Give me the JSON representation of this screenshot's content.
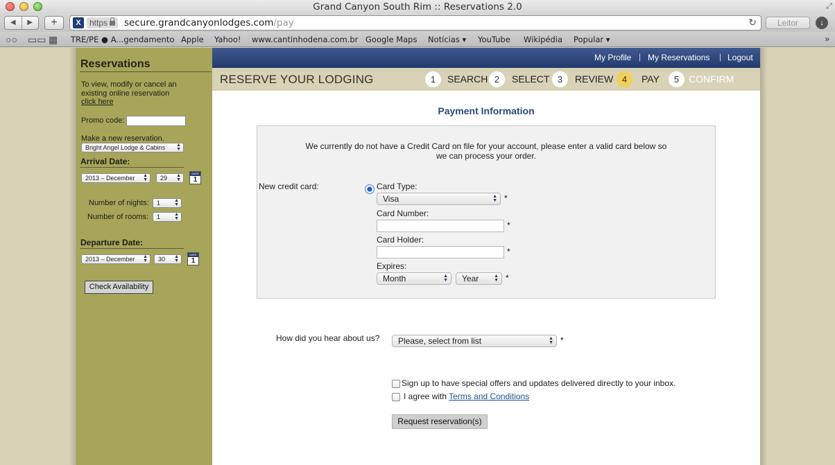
{
  "window": {
    "title": "Grand Canyon South Rim :: Reservations 2.0"
  },
  "browser": {
    "url_scheme": "https",
    "url_host": "secure.grandcanyonlodges.com",
    "url_path": "/pay",
    "reader_label": "Leitor",
    "bookmarks": [
      "TRE/PE ● A...gendamento",
      "Apple",
      "Yahoo!",
      "www.cantinhodena.com.br",
      "Google Maps",
      "Notícias ▾",
      "YouTube",
      "Wikipédia",
      "Popular ▾"
    ]
  },
  "sidebar": {
    "title": "Reservations",
    "modify_text": "To view, modify or cancel an existing online reservation",
    "click_here": "click here",
    "promo_label": "Promo code:",
    "promo_value": "",
    "new_res_label": "Make a new reservation.",
    "lodge_select": "Bright Angel Lodge & Cabins",
    "arrival_head": "Arrival Date:",
    "arrival_month": "2013 – December",
    "arrival_day": "29",
    "nights_label": "Number of nights:",
    "nights_value": "1",
    "rooms_label": "Number of rooms:",
    "rooms_value": "1",
    "departure_head": "Departure Date:",
    "departure_month": "2013 – December",
    "departure_day": "30",
    "cal_label": "DATE",
    "cal_num": "1",
    "check_button": "Check Availability"
  },
  "topnav": {
    "profile": "My Profile",
    "reservations": "My Reservations",
    "logout": "Logout",
    "sep": "|"
  },
  "steps": {
    "title": "RESERVE YOUR LODGING",
    "items": [
      {
        "num": "1",
        "label": "SEARCH"
      },
      {
        "num": "2",
        "label": "SELECT"
      },
      {
        "num": "3",
        "label": "REVIEW"
      },
      {
        "num": "4",
        "label": "PAY"
      },
      {
        "num": "5",
        "label": "CONFIRM"
      }
    ],
    "active_step": 4
  },
  "payment": {
    "title": "Payment Information",
    "message": "We currently do not have a Credit Card on file for your account, please enter a valid card below so we can process your order.",
    "new_card_label": "New credit card:",
    "card_type_label": "Card Type:",
    "card_type_value": "Visa",
    "card_number_label": "Card Number:",
    "card_holder_label": "Card Holder:",
    "expires_label": "Expires:",
    "month_value": "Month",
    "year_value": "Year",
    "required_mark": "*"
  },
  "hear": {
    "label": "How did you hear about us?",
    "value": "Please, select from list"
  },
  "signup_label": "Sign up to have special offers and updates delivered directly to your inbox.",
  "agree_prefix": "I agree with",
  "terms_link": "Terms and Conditions",
  "submit_button": "Request reservation(s)",
  "colors": {
    "sidebar": "#a6a55a",
    "nav": "#2c4477",
    "stepbar": "#d8d2b6",
    "active_step": "#f3cf58",
    "title": "#2c4a7c"
  }
}
